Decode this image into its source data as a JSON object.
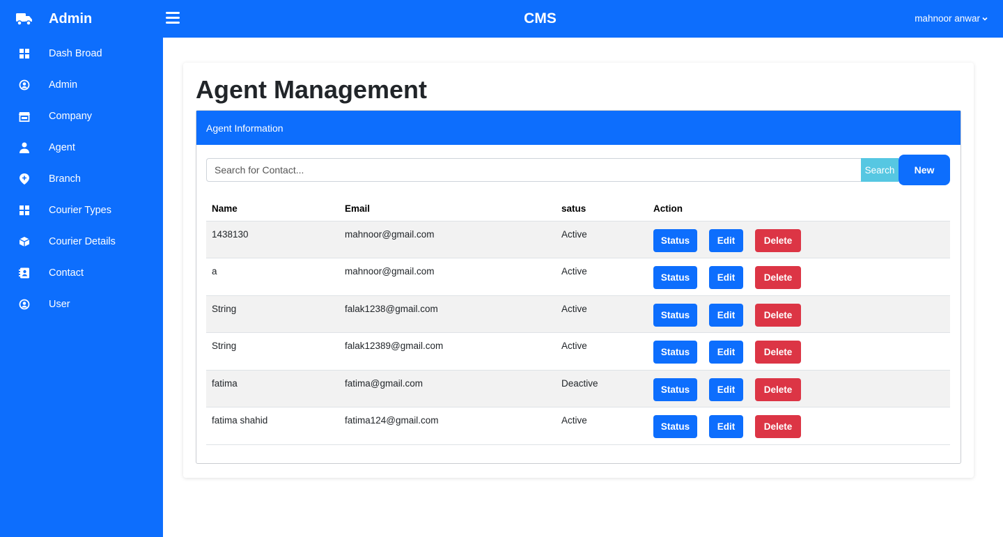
{
  "sidebar": {
    "brand_icon": "truck-icon",
    "brand_title": "Admin",
    "items": [
      {
        "label": "Dash Broad",
        "icon": "dashboard-icon"
      },
      {
        "label": "Admin",
        "icon": "user-circle-icon"
      },
      {
        "label": "Company",
        "icon": "store-icon"
      },
      {
        "label": "Agent",
        "icon": "person-icon"
      },
      {
        "label": "Branch",
        "icon": "location-plus-icon"
      },
      {
        "label": "Courier Types",
        "icon": "grid-icon"
      },
      {
        "label": "Courier Details",
        "icon": "box-icon"
      },
      {
        "label": "Contact",
        "icon": "contact-card-icon"
      },
      {
        "label": "User",
        "icon": "user-circle-icon"
      }
    ]
  },
  "topbar": {
    "title": "CMS",
    "user_name": "mahnoor anwar"
  },
  "main": {
    "page_title": "Agent Management",
    "panel_title": "Agent Information",
    "search": {
      "placeholder": "Search for Contact...",
      "button_label": "Search"
    },
    "new_label": "New",
    "columns": [
      "Name",
      "Email",
      "satus",
      "Action"
    ],
    "rows": [
      {
        "name": "1438130",
        "email": "mahnoor@gmail.com",
        "status": "Active"
      },
      {
        "name": "a",
        "email": "mahnoor@gmail.com",
        "status": "Active"
      },
      {
        "name": "String",
        "email": "falak1238@gmail.com",
        "status": "Active"
      },
      {
        "name": "String",
        "email": "falak12389@gmail.com",
        "status": "Active"
      },
      {
        "name": "fatima",
        "email": "fatima@gmail.com",
        "status": "Deactive"
      },
      {
        "name": "fatima shahid",
        "email": "fatima124@gmail.com",
        "status": "Active"
      }
    ],
    "actions": {
      "status_label": "Status",
      "edit_label": "Edit",
      "delete_label": "Delete"
    }
  },
  "colors": {
    "primary": "#0d6efd",
    "danger": "#dc3545",
    "info": "#56c7e2",
    "stripe": "#f2f2f2"
  }
}
